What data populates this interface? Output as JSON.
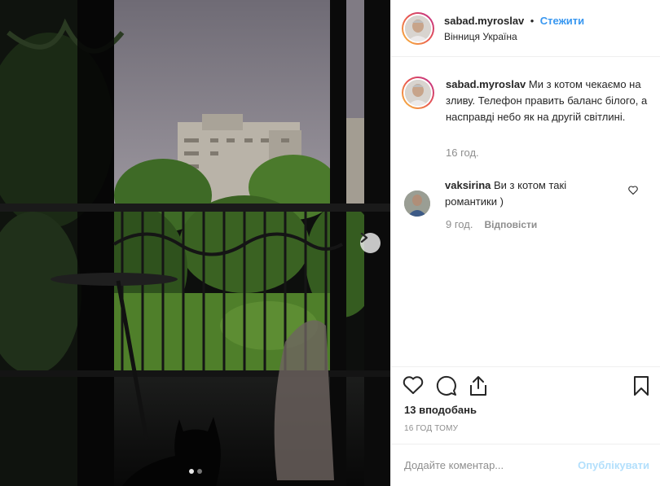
{
  "post": {
    "username": "sabad.myroslav",
    "separator": "•",
    "follow_label": "Стежити",
    "location": "Вінниця Україна",
    "caption_user": "sabad.myroslav",
    "caption_text": "Ми з котом чекаємо на зливу. Телефон править баланс білого, а насправді небо як на другій світлині.",
    "caption_time": "16 год."
  },
  "comments": [
    {
      "user": "vaksirina",
      "text": "Ви з котом такі романтики )",
      "time": "9 год.",
      "reply_label": "Відповісти"
    }
  ],
  "actions": {
    "likes": "13 вподобань",
    "posted": "16 ГОД ТОМУ"
  },
  "add_comment": {
    "placeholder": "Додайте коментар...",
    "publish_label": "Опублікувати"
  },
  "carousel": {
    "total_slides": 2,
    "active_slide": 1
  },
  "colors": {
    "accent": "#3897f0",
    "text": "#262626",
    "muted": "#8e8e8e",
    "publish_disabled": "#b2dffc"
  }
}
